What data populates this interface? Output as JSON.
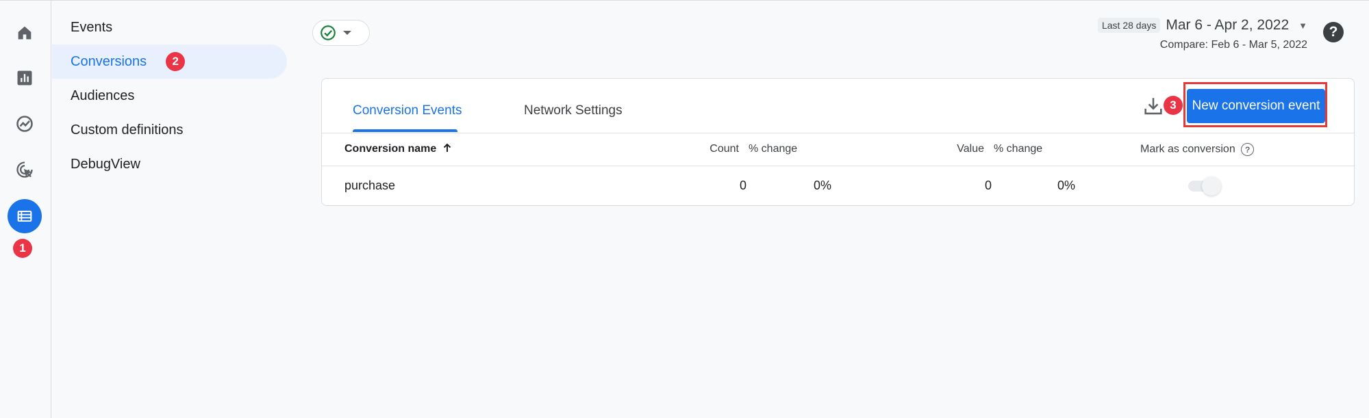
{
  "rail": {
    "items": [
      {
        "name": "home",
        "icon": "home-icon"
      },
      {
        "name": "reports",
        "icon": "bar-chart-icon"
      },
      {
        "name": "explore",
        "icon": "explore-trend-icon"
      },
      {
        "name": "advertising",
        "icon": "cursor-target-icon"
      },
      {
        "name": "configure",
        "icon": "list-configure-icon",
        "active": true
      }
    ],
    "step_badge": "1"
  },
  "subnav": {
    "items": [
      {
        "label": "Events"
      },
      {
        "label": "Conversions",
        "active": true,
        "badge": "2"
      },
      {
        "label": "Audiences"
      },
      {
        "label": "Custom definitions"
      },
      {
        "label": "DebugView"
      }
    ]
  },
  "header": {
    "status_icon": "check-circle-icon",
    "date_chip": "Last 28 days",
    "date_range": "Mar 6 - Apr 2, 2022",
    "compare": "Compare: Feb 6 - Mar 5, 2022",
    "help": "?"
  },
  "card": {
    "tabs": [
      {
        "label": "Conversion Events",
        "active": true
      },
      {
        "label": "Network Settings"
      }
    ],
    "step_badge": "3",
    "new_button": "New conversion event",
    "columns": {
      "name": "Conversion name",
      "count": "Count",
      "count_change": "% change",
      "value": "Value",
      "value_change": "% change",
      "mark": "Mark as conversion"
    },
    "rows": [
      {
        "name": "purchase",
        "count": "0",
        "count_change": "0%",
        "value": "0",
        "value_change": "0%",
        "mark_as_conversion": false
      }
    ]
  },
  "colors": {
    "accent": "#1a73e8",
    "badge": "#ea3546",
    "highlight": "#e53935",
    "success": "#188038"
  }
}
